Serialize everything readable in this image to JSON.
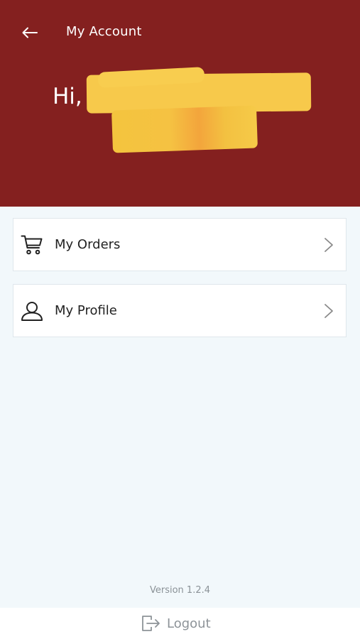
{
  "header": {
    "title": "My Account",
    "greeting": "Hi,",
    "background_color": "#84201f"
  },
  "menu": [
    {
      "label": "My Orders",
      "icon": "cart-icon"
    },
    {
      "label": "My Profile",
      "icon": "user-icon"
    }
  ],
  "footer": {
    "version": "Version 1.2.4",
    "logout_label": "Logout",
    "logout_icon": "logout-icon"
  }
}
